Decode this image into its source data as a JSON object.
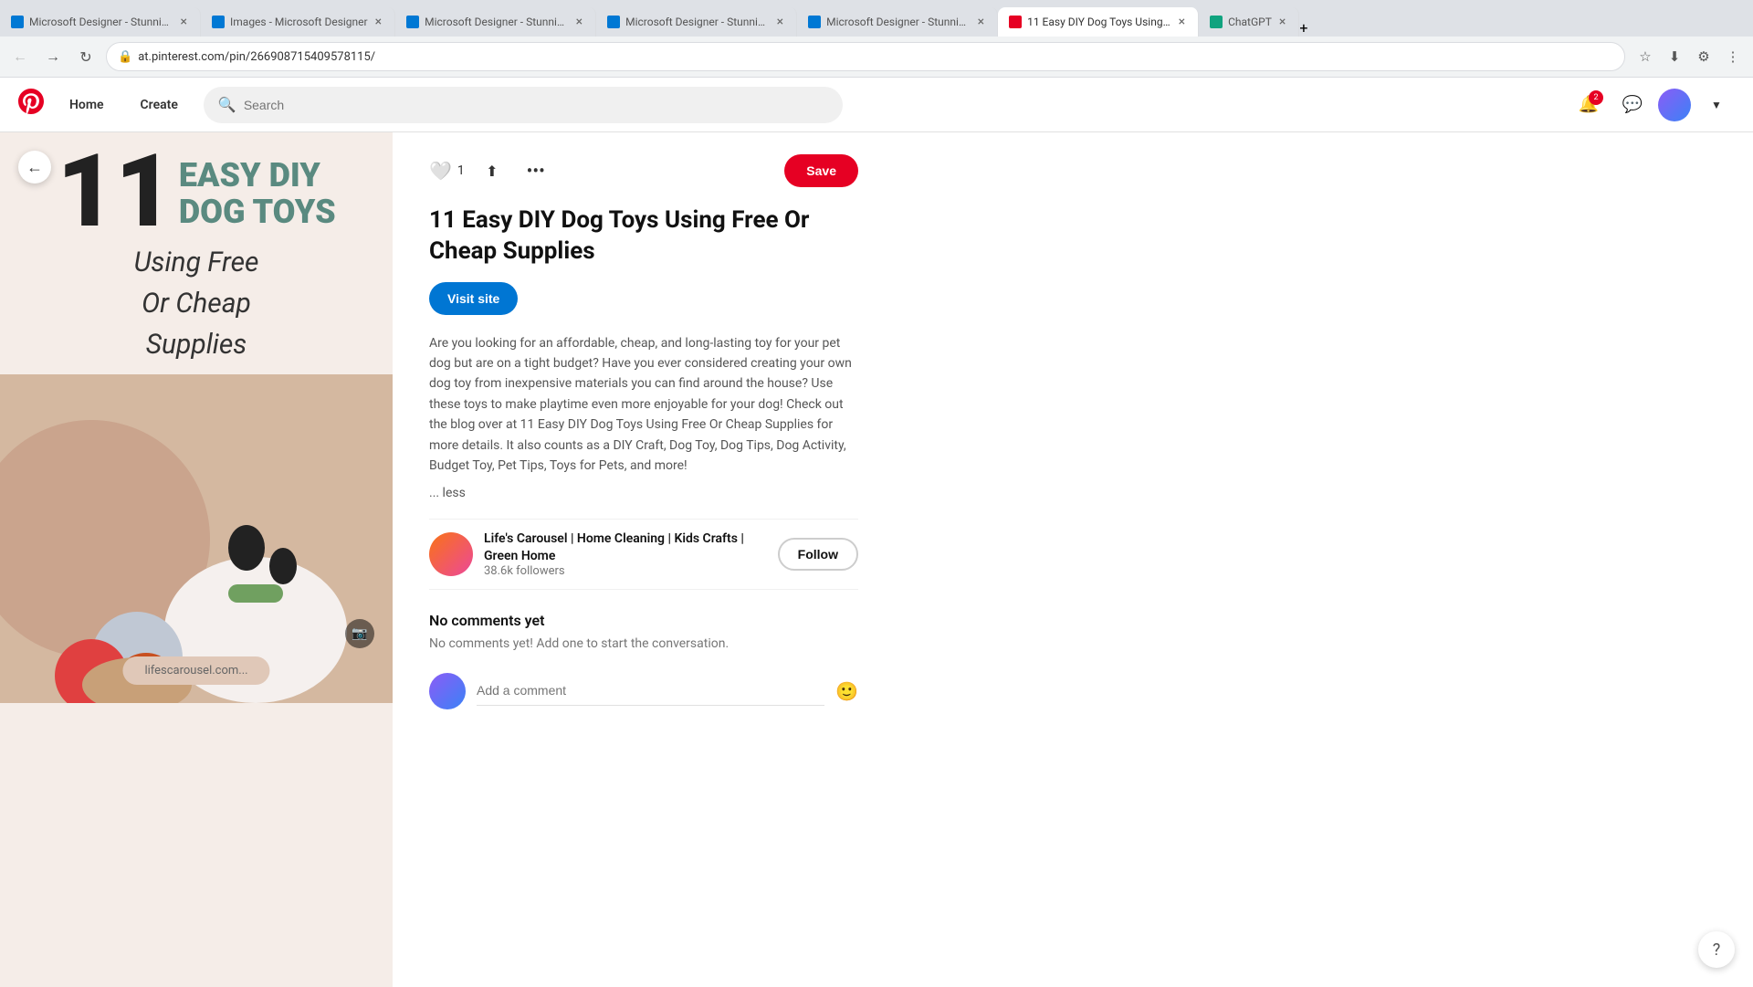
{
  "browser": {
    "tabs": [
      {
        "id": "tab1",
        "title": "Microsoft Designer - Stunning...",
        "favicon": "designer",
        "active": false
      },
      {
        "id": "tab2",
        "title": "Images - Microsoft Designer",
        "favicon": "designer",
        "active": false
      },
      {
        "id": "tab3",
        "title": "Microsoft Designer - Stunning...",
        "favicon": "designer",
        "active": false
      },
      {
        "id": "tab4",
        "title": "Microsoft Designer - Stunning...",
        "favicon": "designer",
        "active": false
      },
      {
        "id": "tab5",
        "title": "Microsoft Designer - Stunning...",
        "favicon": "designer",
        "active": false
      },
      {
        "id": "tab6",
        "title": "11 Easy DIY Dog Toys Using Fr...",
        "favicon": "pinterest",
        "active": true
      },
      {
        "id": "tab7",
        "title": "ChatGPT",
        "favicon": "chatgpt",
        "active": false
      }
    ],
    "url": "at.pinterest.com/pin/266908715409578115/"
  },
  "pinterest": {
    "header": {
      "home_label": "Home",
      "create_label": "Create",
      "search_placeholder": "Search",
      "notification_count": "2"
    },
    "pin": {
      "title": "11 Easy DIY Dog Toys Using Free Or Cheap Supplies",
      "like_count": "1",
      "visit_site_label": "Visit site",
      "save_label": "Save",
      "description": "Are you looking for an affordable, cheap, and long-lasting toy for your pet dog but are on a tight budget? Have you ever considered creating your own dog toy from inexpensive materials you can find around the house? Use these toys to make playtime even more enjoyable for your dog! Check out the blog over at 11 Easy DIY Dog Toys Using Free Or Cheap Supplies for more details. It also counts as a DIY Craft, Dog Toy, Dog Tips, Dog Activity, Budget Toy, Pet Tips, Toys for Pets, and more!",
      "less_label": "... less",
      "author": {
        "name": "Life's Carousel | Home Cleaning | Kids Crafts | Green Home",
        "followers": "38.6k followers",
        "follow_label": "Follow"
      },
      "comments": {
        "title": "No comments yet",
        "empty_message": "No comments yet! Add one to start the conversation.",
        "input_placeholder": "Add a comment"
      },
      "image": {
        "big_number": "11",
        "diy_label": "EASY DIY",
        "dog_toys_label": "DOG TOYS",
        "subtitle_line1": "Using Free",
        "subtitle_line2": "Or Cheap",
        "subtitle_line3": "Supplies",
        "website": "lifescarousel.com..."
      }
    }
  },
  "help_button": "?"
}
